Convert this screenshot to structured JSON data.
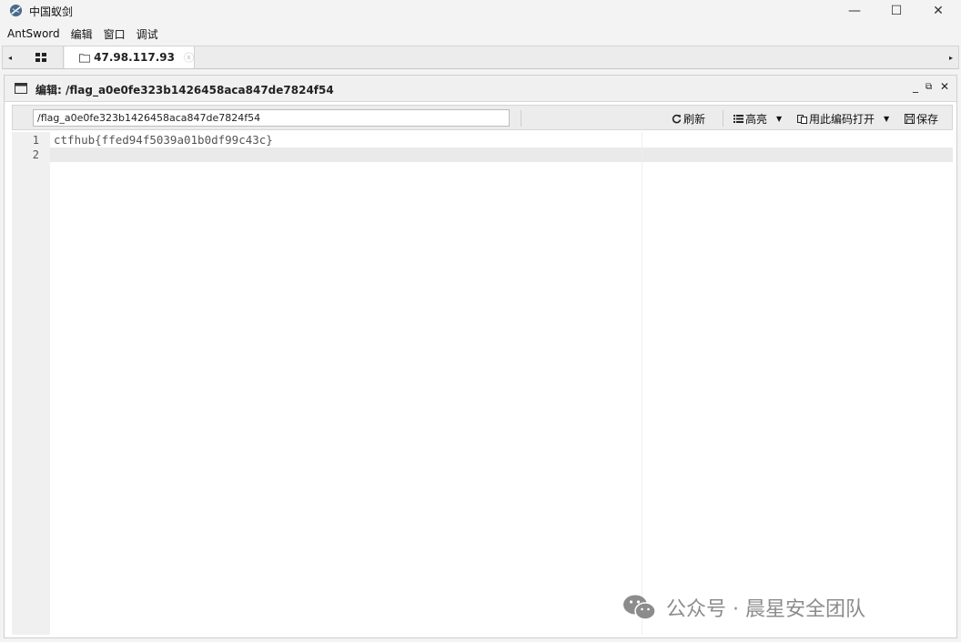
{
  "window": {
    "title": "中国蚁剑",
    "controls": {
      "minimize": "—",
      "maximize": "☐",
      "close": "✕"
    }
  },
  "menu": [
    "AntSword",
    "编辑",
    "窗口",
    "调试"
  ],
  "tabs": {
    "prev_arrow": "◂",
    "next_arrow": "▸",
    "home_icon": "grid-icon",
    "active_tab": {
      "label": "47.98.117.93",
      "close": "ⓧ"
    }
  },
  "panel": {
    "title": "编辑: /flag_a0e0fe323b1426458aca847de7824f54",
    "controls": {
      "minimize": "_",
      "restore": "⧉",
      "close": "✕"
    }
  },
  "toolbar": {
    "path_value": "/flag_a0e0fe323b1426458aca847de7824f54",
    "refresh": "刷新",
    "highlight": "高亮",
    "open_with_encoding": "用此编码打开",
    "save": "保存"
  },
  "editor": {
    "line_numbers": [
      "1",
      "2"
    ],
    "lines": [
      "ctfhub{ffed94f5039a01b0df99c43c}",
      ""
    ]
  },
  "watermark": {
    "text": "公众号 · 晨星安全团队"
  }
}
